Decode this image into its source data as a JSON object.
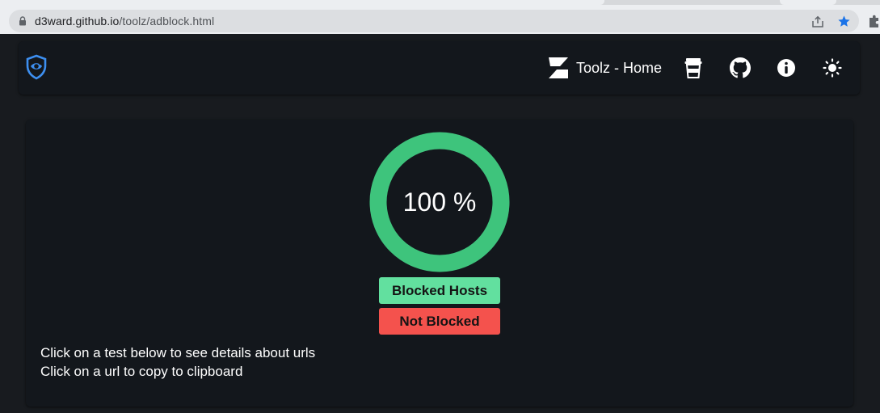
{
  "browser": {
    "url_host": "d3ward.github.io",
    "url_path": "/toolz/adblock.html"
  },
  "navbar": {
    "logo_icon": "shield-eye-icon",
    "home_label": "Toolz - Home",
    "icons": [
      "coffee-cup-icon",
      "github-icon",
      "info-icon",
      "sun-icon"
    ]
  },
  "gauge": {
    "percent": 100,
    "label": "100 %",
    "color": "#3ec47c"
  },
  "legend": {
    "blocked_label": "Blocked Hosts",
    "blocked_color": "#62e09f",
    "not_blocked_label": "Not Blocked",
    "not_blocked_color": "#f4524d"
  },
  "instructions": {
    "line1": "Click on a test below to see details about urls",
    "line2": "Click on a url to copy to clipboard"
  }
}
